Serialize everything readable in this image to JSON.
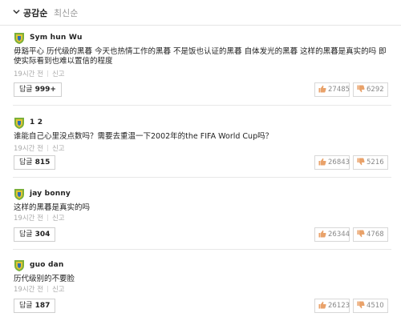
{
  "sort": {
    "active_label": "공감순",
    "inactive_label": "최신순"
  },
  "comments": [
    {
      "username": "Sym hun Wu",
      "text": "毋豁平心 历代级的黑暮 今天也热情工作的黑暮 不是饭也认证的黑暮 自体发光的黑暮 这样的黑暮是真实的吗 即使实际看到也难以置信的程度",
      "time": "19시간 전",
      "report": "신고",
      "reply_label": "답글",
      "reply_count": "999+",
      "likes": "27485",
      "dislikes": "6292"
    },
    {
      "username": "1 2",
      "text": "谁能自己心里没点数吗？需要去重温一下2002年的the FIFA World Cup吗？",
      "time": "19시간 전",
      "report": "신고",
      "reply_label": "답글",
      "reply_count": "815",
      "likes": "26843",
      "dislikes": "5216"
    },
    {
      "username": "jay bonny",
      "text": "这样的黑暮是真实的吗",
      "time": "19시간 전",
      "report": "신고",
      "reply_label": "답글",
      "reply_count": "304",
      "likes": "26344",
      "dislikes": "4768"
    },
    {
      "username": "guo dan",
      "text": "历代级别的不要脸",
      "time": "19시간 전",
      "report": "신고",
      "reply_label": "답글",
      "reply_count": "187",
      "likes": "26123",
      "dislikes": "4510"
    }
  ],
  "icons": {
    "sort": "chevron-down-icon",
    "avatar": "shield-avatar-icon",
    "like": "thumbs-up-icon",
    "dislike": "thumbs-down-icon"
  },
  "colors": {
    "avatar_green": "#7bb03a",
    "avatar_yellow": "#e2c531",
    "avatar_blue": "#2c6fb7",
    "like_icon": "#e9a26a",
    "dislike_icon": "#e9a26a"
  }
}
